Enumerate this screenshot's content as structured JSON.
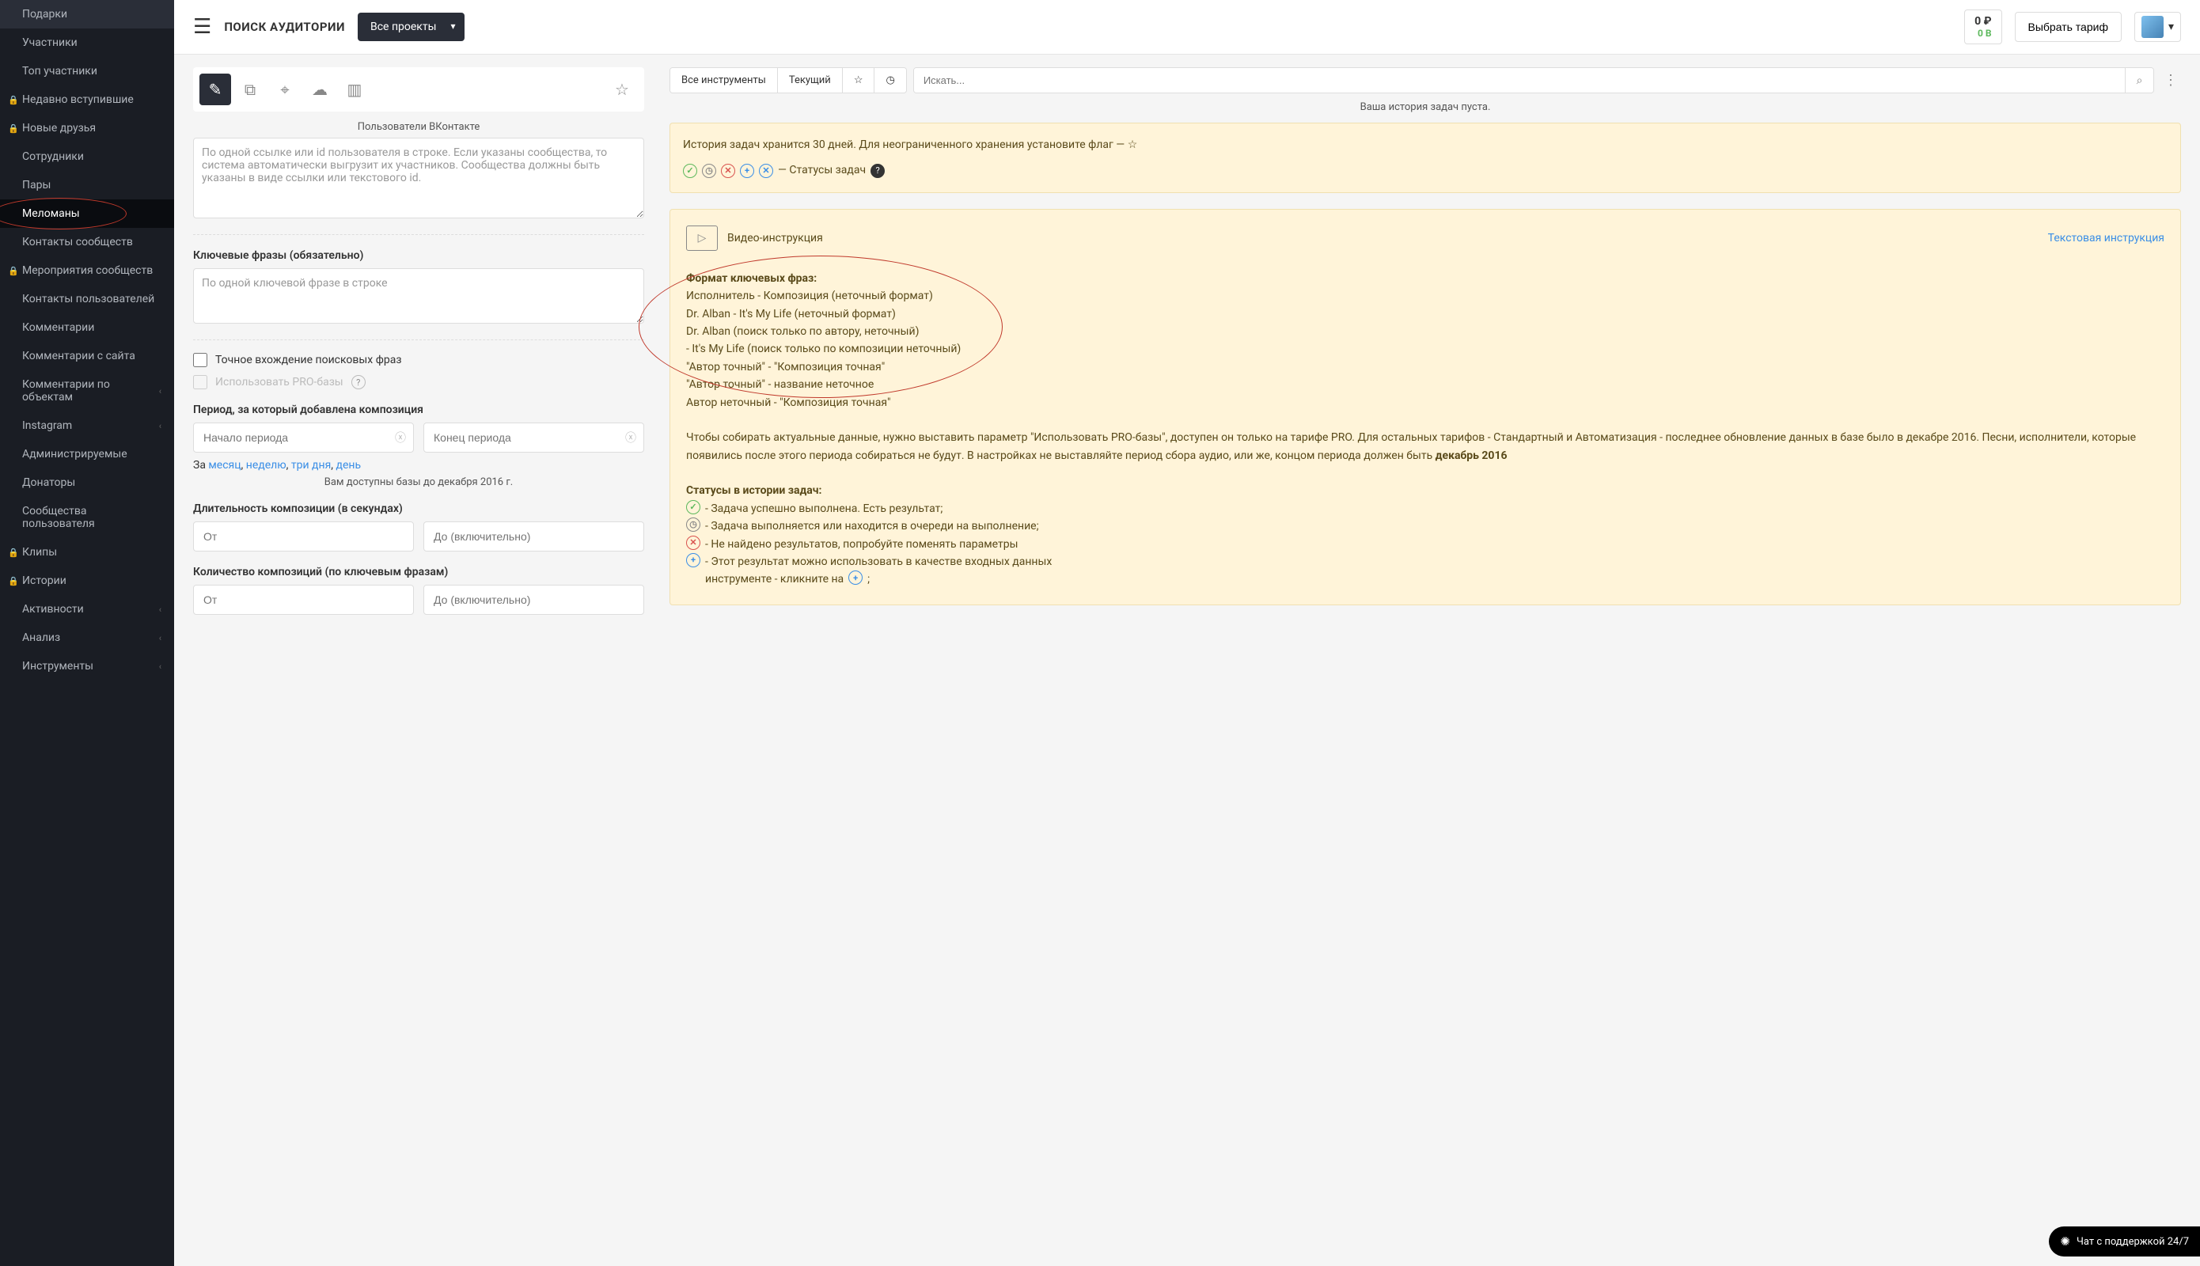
{
  "header": {
    "title": "ПОИСК АУДИТОРИИ",
    "project_select": "Все проекты",
    "balance_rub": "0 ₽",
    "balance_b": "0 B",
    "tariff_btn": "Выбрать тариф"
  },
  "sidebar": {
    "items": [
      {
        "label": "Подарки",
        "lock": false
      },
      {
        "label": "Участники",
        "lock": false
      },
      {
        "label": "Топ участники",
        "lock": false
      },
      {
        "label": "Недавно вступившие",
        "lock": true
      },
      {
        "label": "Новые друзья",
        "lock": true
      },
      {
        "label": "Сотрудники",
        "lock": false
      },
      {
        "label": "Пары",
        "lock": false
      },
      {
        "label": "Меломаны",
        "lock": false,
        "active": true
      },
      {
        "label": "Контакты сообществ",
        "lock": false
      },
      {
        "label": "Мероприятия сообществ",
        "lock": true
      },
      {
        "label": "Контакты пользователей",
        "lock": false
      },
      {
        "label": "Комментарии",
        "lock": false
      },
      {
        "label": "Комментарии с сайта",
        "lock": false
      },
      {
        "label": "Комментарии по объектам",
        "lock": false,
        "chevron": true
      },
      {
        "label": "Instagram",
        "lock": false,
        "chevron": true
      },
      {
        "label": "Администрируемые",
        "lock": false
      },
      {
        "label": "Донаторы",
        "lock": false
      },
      {
        "label": "Сообщества пользователя",
        "lock": false
      },
      {
        "label": "Клипы",
        "lock": true
      },
      {
        "label": "Истории",
        "lock": true
      },
      {
        "label": "Активности",
        "lock": false,
        "chevron": true
      },
      {
        "label": "Анализ",
        "lock": false,
        "chevron": true
      },
      {
        "label": "Инструменты",
        "lock": false,
        "chevron": true
      }
    ]
  },
  "form": {
    "users_label": "Пользователи ВКонтакте",
    "users_placeholder": "По одной ссылке или id пользователя в строке. Если указаны сообщества, то система автоматически выгрузит их участников. Сообщества должны быть указаны в виде ссылки или текстового id.",
    "keyphrase_label": "Ключевые фразы (обязательно)",
    "keyphrase_placeholder": "По одной ключевой фразе в строке",
    "exact_match_label": "Точное вхождение поисковых фраз",
    "pro_base_label": "Использовать PRO-базы",
    "period_label": "Период, за который добавлена композиция",
    "period_start_placeholder": "Начало периода",
    "period_end_placeholder": "Конец периода",
    "quick_prefix": "За ",
    "quick_month": "месяц",
    "quick_week": "неделю",
    "quick_3days": "три дня",
    "quick_day": "день",
    "quick_comma": ", ",
    "bases_hint": "Вам доступны базы до декабря 2016 г.",
    "duration_label": "Длительность композиции (в секундах)",
    "count_label": "Количество композиций (по ключевым фразам)",
    "from_placeholder": "От",
    "to_placeholder": "До (включительно)"
  },
  "right": {
    "tab_all": "Все инструменты",
    "tab_current": "Текущий",
    "search_placeholder": "Искать...",
    "history_empty": "Ваша история задач пуста.",
    "info_text": "История задач хранится 30 дней. Для неограниченного хранения установите флаг — ☆",
    "info_statuses": " — Статусы задач ",
    "guide_video": "Видео-инструкция",
    "guide_text": "Текстовая инструкция",
    "format_title": "Формат ключевых фраз:",
    "format_lines": [
      "Исполнитель - Композиция (неточный формат)",
      "Dr. Alban - It's My Life (неточный формат)",
      "Dr. Alban (поиск только по автору, неточный)",
      "- It's My Life (поиск только по композиции неточный)",
      "\"Автор точный\" - \"Композиция точная\"",
      "\"Автор точный\" - название неточное",
      "Автор неточный - \"Композиция точная\""
    ],
    "pro_note_1": "Чтобы собирать актуальные данные, нужно выставить параметр \"Использовать PRO-базы\", доступен он только на тарифе PRO. Для остальных тарифов - Стандартный и Автоматизация - последнее обновление данных в базе было в декабре 2016. Песни, исполнители, которые появились после этого периода собираться не будут. В настройках не выставляйте период сбора аудио, или же, концом периода должен быть ",
    "pro_note_bold": "декабрь 2016",
    "statuses_title": "Статусы в истории задач:",
    "status_ok": " - Задача успешно выполнена. Есть результат;",
    "status_clock": " - Задача выполняется или находится в очереди на выполнение;",
    "status_err": " - Не найдено результатов, попробуйте поменять параметры",
    "status_plus_1": " - Этот результат можно использовать в качестве входных данных",
    "status_plus_2": "инструменте - кликните на "
  },
  "chat": {
    "label": "Чат с поддержкой 24/7"
  }
}
